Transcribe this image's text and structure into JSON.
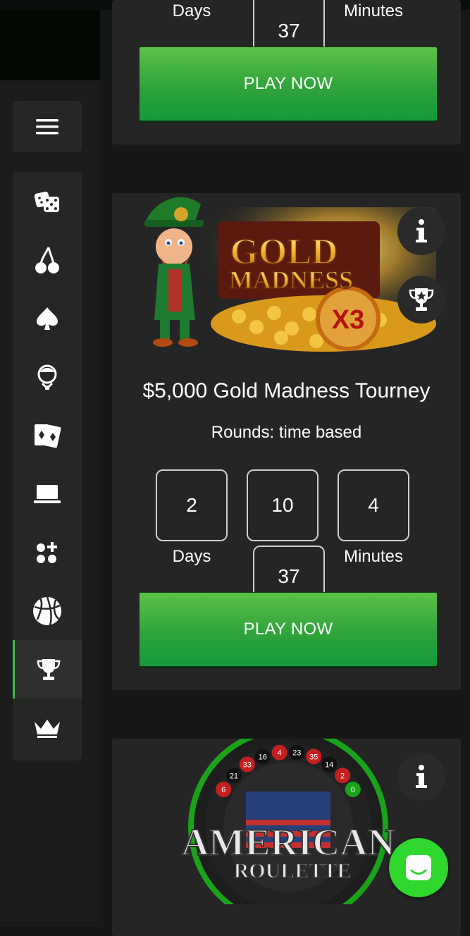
{
  "sidebar": {
    "menu_icon": "hamburger-icon",
    "items": [
      {
        "icon": "dice-icon"
      },
      {
        "icon": "cherries-icon"
      },
      {
        "icon": "spade-icon"
      },
      {
        "icon": "dealer-icon"
      },
      {
        "icon": "cards-icon"
      },
      {
        "icon": "laptop-icon"
      },
      {
        "icon": "dots-plus-icon"
      },
      {
        "icon": "basketball-icon"
      },
      {
        "icon": "trophy-icon",
        "active": true
      },
      {
        "icon": "crown-icon"
      }
    ],
    "accent": "#3fb94a"
  },
  "card_top": {
    "countdown": {
      "days_label": "Days",
      "minutes_label": "Minutes",
      "hours_value": "37"
    },
    "play_label": "PLAY NOW"
  },
  "tourney": {
    "banner": {
      "line1": "GOLD",
      "line2": "MADNESS",
      "badge": "X3"
    },
    "title": "$5,000 Gold Madness Tourney",
    "rounds": "Rounds: time based",
    "countdown": {
      "days": "2",
      "days_label": "Days",
      "hours": "10",
      "minutes": "4",
      "minutes_label": "Minutes",
      "seconds": "37"
    },
    "play_label": "PLAY NOW"
  },
  "roulette": {
    "banner": {
      "line1": "AMERICAN",
      "line2": "ROULETTE",
      "wheel_numbers": [
        "6",
        "21",
        "33",
        "16",
        "4",
        "23",
        "35",
        "14",
        "2",
        "0"
      ]
    }
  },
  "colors": {
    "play_green": "#2fa33b",
    "chat_green": "#2fd62b"
  }
}
